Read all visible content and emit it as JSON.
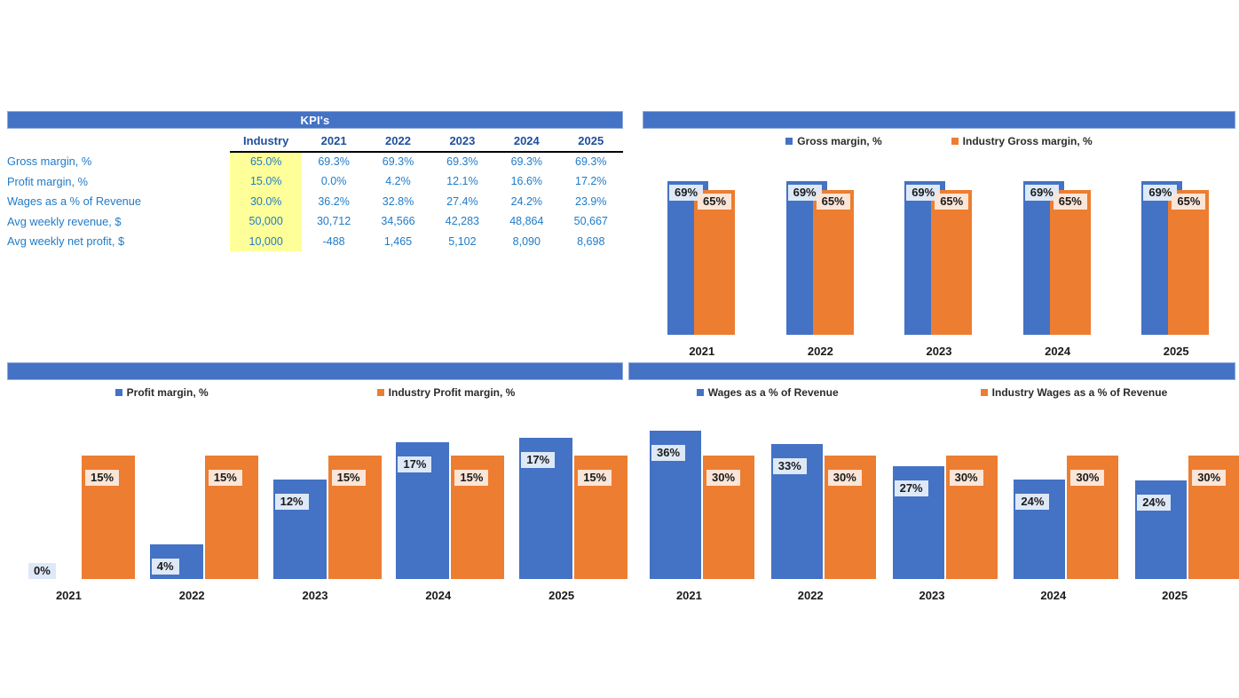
{
  "kpi_table": {
    "title": "KPI's",
    "columns": [
      "",
      "Industry",
      "2021",
      "2022",
      "2023",
      "2024",
      "2025"
    ],
    "rows": [
      {
        "label": "Gross margin, %",
        "industry": "65.0%",
        "values": [
          "69.3%",
          "69.3%",
          "69.3%",
          "69.3%",
          "69.3%"
        ]
      },
      {
        "label": "Profit margin, %",
        "industry": "15.0%",
        "values": [
          "0.0%",
          "4.2%",
          "12.1%",
          "16.6%",
          "17.2%"
        ]
      },
      {
        "label": "Wages as a % of Revenue",
        "industry": "30.0%",
        "values": [
          "36.2%",
          "32.8%",
          "27.4%",
          "24.2%",
          "23.9%"
        ]
      },
      {
        "label": "Avg weekly revenue, $",
        "industry": "50,000",
        "values": [
          "30,712",
          "34,566",
          "42,283",
          "48,864",
          "50,667"
        ]
      },
      {
        "label": "Avg weekly net profit, $",
        "industry": "10,000",
        "values": [
          "-488",
          "1,465",
          "5,102",
          "8,090",
          "8,698"
        ]
      }
    ]
  },
  "charts": [
    {
      "id": "gross-margin-chart",
      "header_title": "",
      "legend": [
        "Gross margin, %",
        "Industry Gross margin, %"
      ],
      "labels": {
        "blue": [
          "69%",
          "69%",
          "69%",
          "69%",
          "69%"
        ],
        "orange": [
          "65%",
          "65%",
          "65%",
          "65%",
          "65%"
        ]
      }
    },
    {
      "id": "profit-margin-chart",
      "header_title": "",
      "legend": [
        "Profit margin, %",
        "Industry Profit margin, %"
      ],
      "labels": {
        "blue": [
          "0%",
          "4%",
          "12%",
          "17%",
          "17%"
        ],
        "orange": [
          "15%",
          "15%",
          "15%",
          "15%",
          "15%"
        ]
      }
    },
    {
      "id": "wages-chart",
      "header_title": "",
      "legend": [
        "Wages as a % of Revenue",
        "Industry Wages as a % of Revenue"
      ],
      "labels": {
        "blue": [
          "36%",
          "33%",
          "27%",
          "24%",
          "24%"
        ],
        "orange": [
          "30%",
          "30%",
          "30%",
          "30%",
          "30%"
        ]
      }
    }
  ],
  "colors": {
    "series_blue": "#4472C4",
    "series_orange": "#ED7D31",
    "header_bar": "#4472C4",
    "highlight_yellow": "#FFFF99",
    "table_text_blue": "#1F7BC8",
    "table_header_blue": "#1F4E9C"
  },
  "chart_data": [
    {
      "type": "bar",
      "id": "gross-margin-chart",
      "title": "",
      "categories": [
        "2021",
        "2022",
        "2023",
        "2024",
        "2025"
      ],
      "series": [
        {
          "name": "Gross margin, %",
          "color": "#4472C4",
          "values": [
            69.3,
            69.3,
            69.3,
            69.3,
            69.3
          ]
        },
        {
          "name": "Industry Gross margin, %",
          "color": "#ED7D31",
          "values": [
            65.0,
            65.0,
            65.0,
            65.0,
            65.0
          ]
        }
      ],
      "data_labels": [
        [
          "69%",
          "69%",
          "69%",
          "69%",
          "69%"
        ],
        [
          "65%",
          "65%",
          "65%",
          "65%",
          "65%"
        ]
      ],
      "xlabel": "",
      "ylabel": "",
      "ylim": [
        0,
        80
      ],
      "grid": false,
      "legend_position": "top",
      "axis_visible": false,
      "overlap": "series overlap; orange bar drawn in front offset right"
    },
    {
      "type": "bar",
      "id": "profit-margin-chart",
      "title": "",
      "categories": [
        "2021",
        "2022",
        "2023",
        "2024",
        "2025"
      ],
      "series": [
        {
          "name": "Profit margin, %",
          "color": "#4472C4",
          "values": [
            0.0,
            4.2,
            12.1,
            16.6,
            17.2
          ]
        },
        {
          "name": "Industry Profit margin, %",
          "color": "#ED7D31",
          "values": [
            15.0,
            15.0,
            15.0,
            15.0,
            15.0
          ]
        }
      ],
      "data_labels": [
        [
          "0%",
          "4%",
          "12%",
          "17%",
          "17%"
        ],
        [
          "15%",
          "15%",
          "15%",
          "15%",
          "15%"
        ]
      ],
      "xlabel": "",
      "ylabel": "",
      "ylim": [
        0,
        20
      ],
      "grid": false,
      "legend_position": "top",
      "axis_visible": false
    },
    {
      "type": "bar",
      "id": "wages-chart",
      "title": "",
      "categories": [
        "2021",
        "2022",
        "2023",
        "2024",
        "2025"
      ],
      "series": [
        {
          "name": "Wages as a % of Revenue",
          "color": "#4472C4",
          "values": [
            36.2,
            32.8,
            27.4,
            24.2,
            23.9
          ]
        },
        {
          "name": "Industry Wages as a % of Revenue",
          "color": "#ED7D31",
          "values": [
            30.0,
            30.0,
            30.0,
            30.0,
            30.0
          ]
        }
      ],
      "data_labels": [
        [
          "36%",
          "33%",
          "27%",
          "24%",
          "24%"
        ],
        [
          "30%",
          "30%",
          "30%",
          "30%",
          "30%"
        ]
      ],
      "xlabel": "",
      "ylabel": "",
      "ylim": [
        0,
        40
      ],
      "grid": false,
      "legend_position": "top",
      "axis_visible": false
    }
  ]
}
